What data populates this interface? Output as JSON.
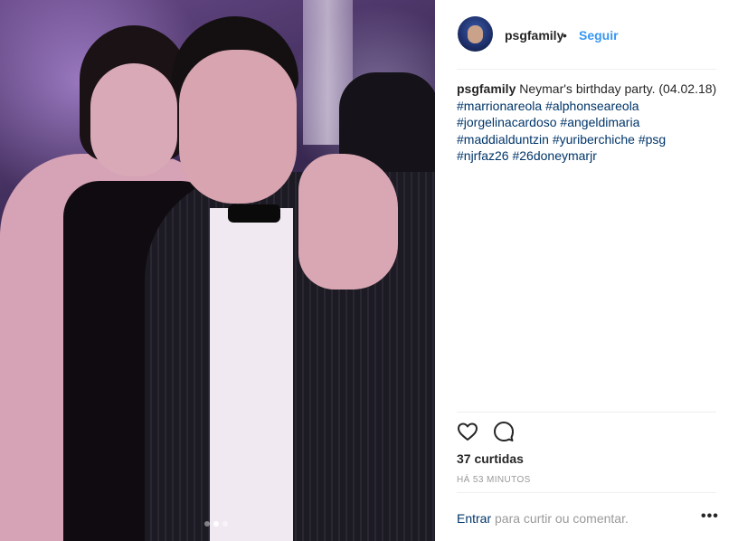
{
  "header": {
    "username": "psgfamily",
    "separator": "•",
    "follow_label": "Seguir"
  },
  "caption": {
    "username": "psgfamily",
    "text": "Neymar's birthday party. (04.02.18)",
    "hashtags": [
      "#marrionareola",
      "#alphonseareola",
      "#jorgelinacardoso",
      "#angeldimaria",
      "#maddialduntzin",
      "#yuriberchiche",
      "#psg",
      "#njrfaz26",
      "#26doneymarjr"
    ]
  },
  "actions": {
    "like_icon": "heart-icon",
    "comment_icon": "comment-icon"
  },
  "likes_text": "37 curtidas",
  "time_text": "HÁ 53 MINUTOS",
  "comment_prompt": {
    "login_label": "Entrar",
    "rest": " para curtir ou comentar."
  },
  "more_label": "•••",
  "carousel": {
    "count": 3,
    "active_index": 1
  },
  "colors": {
    "link_blue": "#3897f0",
    "hashtag": "#003569",
    "muted": "#999999"
  }
}
